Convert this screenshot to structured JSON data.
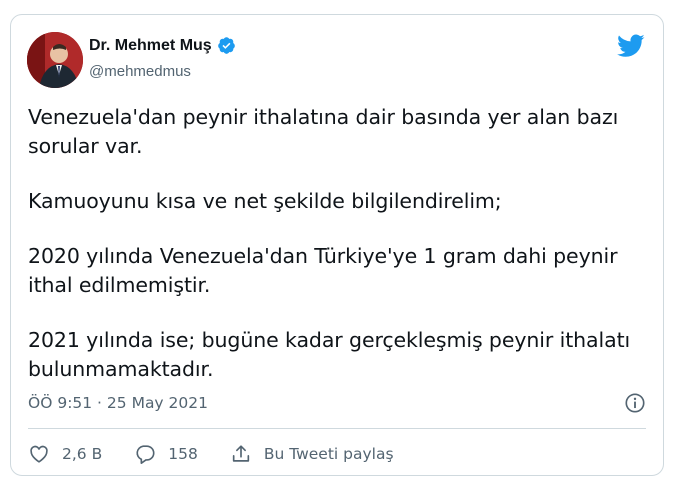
{
  "author": {
    "name": "Dr. Mehmet Muş",
    "handle": "@mehmedmus"
  },
  "tweet": {
    "paragraphs": [
      "Venezuela'dan peynir ithalatına dair basında yer alan bazı sorular var.",
      "Kamuoyunu kısa ve net şekilde bilgilendirelim;",
      "2020 yılında Venezuela'dan Türkiye'ye 1 gram dahi peynir ithal edilmemiştir.",
      "2021 yılında ise; bugüne kadar gerçekleşmiş peynir ithalatı bulunmamaktadır."
    ],
    "timestamp": "ÖÖ 9:51 · 25 May 2021"
  },
  "actions": {
    "likes": "2,6 B",
    "replies": "158",
    "share_label": "Bu Tweeti paylaş"
  },
  "colors": {
    "twitter_blue": "#1d9bf0",
    "secondary_text": "#536471",
    "border": "#cfd9de"
  },
  "icons": [
    "verified-badge-icon",
    "twitter-bird-icon",
    "info-icon",
    "heart-icon",
    "reply-icon",
    "share-icon"
  ]
}
